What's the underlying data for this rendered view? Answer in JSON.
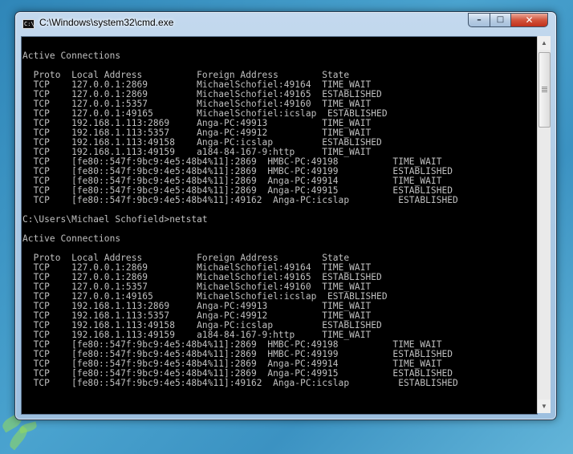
{
  "window": {
    "title": "C:\\Windows\\system32\\cmd.exe",
    "icon_label": "C:\\",
    "buttons": {
      "minimize": "–",
      "maximize": "□",
      "close": "✕"
    }
  },
  "scrollbar": {
    "up": "▲",
    "down": "▼"
  },
  "console": {
    "lines": [
      "",
      "Active Connections",
      "",
      "  Proto  Local Address          Foreign Address        State",
      "  TCP    127.0.0.1:2869         MichaelSchofiel:49164  TIME_WAIT",
      "  TCP    127.0.0.1:2869         MichaelSchofiel:49165  ESTABLISHED",
      "  TCP    127.0.0.1:5357         MichaelSchofiel:49160  TIME_WAIT",
      "  TCP    127.0.0.1:49165        MichaelSchofiel:icslap  ESTABLISHED",
      "  TCP    192.168.1.113:2869     Anga-PC:49913          TIME_WAIT",
      "  TCP    192.168.1.113:5357     Anga-PC:49912          TIME_WAIT",
      "  TCP    192.168.1.113:49158    Anga-PC:icslap         ESTABLISHED",
      "  TCP    192.168.1.113:49159    a184-84-167-9:http     TIME_WAIT",
      "  TCP    [fe80::547f:9bc9:4e5:48b4%11]:2869  HMBC-PC:49198          TIME_WAIT",
      "  TCP    [fe80::547f:9bc9:4e5:48b4%11]:2869  HMBC-PC:49199          ESTABLISHED",
      "  TCP    [fe80::547f:9bc9:4e5:48b4%11]:2869  Anga-PC:49914          TIME_WAIT",
      "  TCP    [fe80::547f:9bc9:4e5:48b4%11]:2869  Anga-PC:49915          ESTABLISHED",
      "  TCP    [fe80::547f:9bc9:4e5:48b4%11]:49162  Anga-PC:icslap         ESTABLISHED",
      "",
      "C:\\Users\\Michael Schofield>netstat",
      "",
      "Active Connections",
      "",
      "  Proto  Local Address          Foreign Address        State",
      "  TCP    127.0.0.1:2869         MichaelSchofiel:49164  TIME_WAIT",
      "  TCP    127.0.0.1:2869         MichaelSchofiel:49165  ESTABLISHED",
      "  TCP    127.0.0.1:5357         MichaelSchofiel:49160  TIME_WAIT",
      "  TCP    127.0.0.1:49165        MichaelSchofiel:icslap  ESTABLISHED",
      "  TCP    192.168.1.113:2869     Anga-PC:49913          TIME_WAIT",
      "  TCP    192.168.1.113:5357     Anga-PC:49912          TIME_WAIT",
      "  TCP    192.168.1.113:49158    Anga-PC:icslap         ESTABLISHED",
      "  TCP    192.168.1.113:49159    a184-84-167-9:http     TIME_WAIT",
      "  TCP    [fe80::547f:9bc9:4e5:48b4%11]:2869  HMBC-PC:49198          TIME_WAIT",
      "  TCP    [fe80::547f:9bc9:4e5:48b4%11]:2869  HMBC-PC:49199          ESTABLISHED",
      "  TCP    [fe80::547f:9bc9:4e5:48b4%11]:2869  Anga-PC:49914          TIME_WAIT",
      "  TCP    [fe80::547f:9bc9:4e5:48b4%11]:2869  Anga-PC:49915          ESTABLISHED",
      "  TCP    [fe80::547f:9bc9:4e5:48b4%11]:49162  Anga-PC:icslap         ESTABLISHED"
    ]
  }
}
